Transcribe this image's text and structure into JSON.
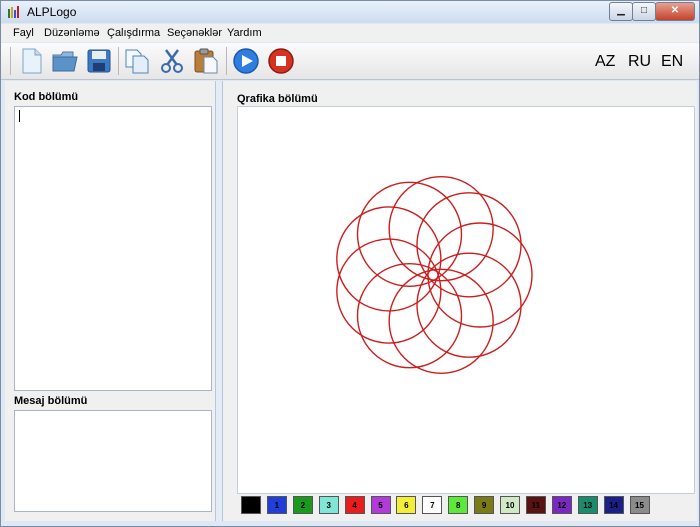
{
  "window": {
    "title": "ALPLogo",
    "controls": {
      "minimize": "▁",
      "maximize": "□",
      "close": "✕"
    }
  },
  "menu": {
    "items": [
      {
        "label": "Fayl"
      },
      {
        "label": "Düzənləmə"
      },
      {
        "label": "Çalışdırma"
      },
      {
        "label": "Seçənəklər"
      },
      {
        "label": "Yardım"
      }
    ]
  },
  "toolbar": {
    "buttons": [
      {
        "name": "new-file-button",
        "icon": "new-document-icon"
      },
      {
        "name": "open-file-button",
        "icon": "folder-icon"
      },
      {
        "name": "save-button",
        "icon": "floppy-disk-icon"
      },
      {
        "name": "copy-button",
        "icon": "copy-icon"
      },
      {
        "name": "cut-button",
        "icon": "scissors-icon"
      },
      {
        "name": "paste-button",
        "icon": "clipboard-icon"
      },
      {
        "name": "run-button",
        "icon": "play-icon"
      },
      {
        "name": "stop-button",
        "icon": "stop-icon"
      }
    ],
    "languages": [
      "AZ",
      "RU",
      "EN"
    ]
  },
  "left": {
    "code_label": "Kod bölümü",
    "message_label": "Mesaj bölümü"
  },
  "right": {
    "graphics_label": "Qrafika bölümü",
    "drawing_color": "#cc1e1e"
  },
  "palette": [
    {
      "label": "",
      "color": "#000000"
    },
    {
      "label": "1",
      "color": "#1f3fd8"
    },
    {
      "label": "2",
      "color": "#1a9a1a"
    },
    {
      "label": "3",
      "color": "#7fe6d8"
    },
    {
      "label": "4",
      "color": "#e81e1e"
    },
    {
      "label": "5",
      "color": "#b23ad6"
    },
    {
      "label": "6",
      "color": "#f2ee3a"
    },
    {
      "label": "7",
      "color": "#ffffff"
    },
    {
      "label": "8",
      "color": "#5de83a"
    },
    {
      "label": "9",
      "color": "#7a7a16"
    },
    {
      "label": "10",
      "color": "#cfeac4"
    },
    {
      "label": "11",
      "color": "#5a1212"
    },
    {
      "label": "12",
      "color": "#7b27c2"
    },
    {
      "label": "13",
      "color": "#198c6e"
    },
    {
      "label": "14",
      "color": "#1a1f8a"
    },
    {
      "label": "15",
      "color": "#8c8c8c"
    }
  ]
}
